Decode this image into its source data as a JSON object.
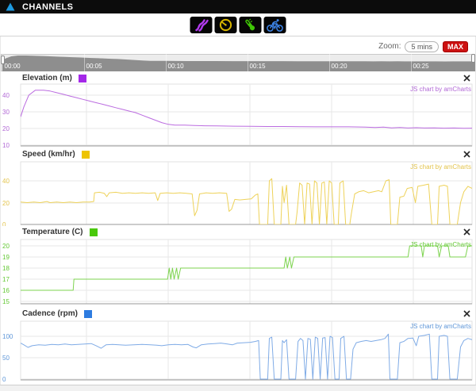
{
  "header": {
    "title": "CHANNELS"
  },
  "toolbar": {
    "buttons": [
      {
        "id": "elevation",
        "icon": "waves-icon",
        "color": "#b23aee"
      },
      {
        "id": "speed",
        "icon": "speedometer-icon",
        "color": "#d8b600"
      },
      {
        "id": "temperature",
        "icon": "thermometer-icon",
        "color": "#3fc506"
      },
      {
        "id": "cadence",
        "icon": "cyclist-icon",
        "color": "#3d85ea"
      }
    ]
  },
  "zoom_controls": {
    "label": "Zoom:",
    "preset_label": "5 mins",
    "max_label": "MAX",
    "max_color": "#cc1111"
  },
  "scrubber": {
    "time_labels": [
      "00:00",
      "00:05",
      "00:10",
      "00:15",
      "00:20",
      "00:25"
    ]
  },
  "amcharts_credit": "JS chart by amCharts",
  "chart_data": [
    {
      "type": "line",
      "title": "Elevation (m)",
      "swatch_color": "#a428e8",
      "line_color": "#bb6ce0",
      "label_color": "#b269d6",
      "yticks": [
        40,
        30,
        20,
        10
      ],
      "ylim": [
        9,
        46
      ],
      "x_range_minutes": [
        0,
        27.5
      ],
      "points": [
        [
          0,
          27
        ],
        [
          0.2,
          33
        ],
        [
          0.5,
          40
        ],
        [
          0.9,
          43
        ],
        [
          1.4,
          43
        ],
        [
          1.8,
          42.5
        ],
        [
          2.2,
          41.5
        ],
        [
          2.6,
          40.5
        ],
        [
          3,
          39.5
        ],
        [
          3.4,
          38.5
        ],
        [
          3.8,
          37.5
        ],
        [
          4.2,
          36.5
        ],
        [
          4.6,
          35.5
        ],
        [
          5,
          34.5
        ],
        [
          5.4,
          33.5
        ],
        [
          5.8,
          32.5
        ],
        [
          6.2,
          31.5
        ],
        [
          6.6,
          30.5
        ],
        [
          7,
          29.5
        ],
        [
          7.4,
          28
        ],
        [
          7.8,
          26.5
        ],
        [
          8.2,
          25
        ],
        [
          8.6,
          23.5
        ],
        [
          9,
          22.5
        ],
        [
          9.4,
          22
        ],
        [
          10,
          22
        ],
        [
          10.6,
          21.8
        ],
        [
          11.2,
          21.6
        ],
        [
          12,
          21.5
        ],
        [
          13,
          21.4
        ],
        [
          14,
          21.3
        ],
        [
          15,
          21.2
        ],
        [
          16,
          21.2
        ],
        [
          17,
          21.1
        ],
        [
          18,
          21
        ],
        [
          19,
          21
        ],
        [
          20,
          21
        ],
        [
          21,
          20.8
        ],
        [
          21.6,
          20.6
        ],
        [
          22.1,
          20.8
        ],
        [
          22.6,
          20.4
        ],
        [
          23.1,
          20.6
        ],
        [
          23.6,
          20.3
        ],
        [
          24.1,
          20.5
        ],
        [
          24.6,
          20.3
        ],
        [
          25.2,
          20.4
        ],
        [
          25.8,
          20.2
        ],
        [
          26.4,
          20.3
        ],
        [
          27,
          20.1
        ],
        [
          27.5,
          20.2
        ]
      ]
    },
    {
      "type": "line",
      "title": "Speed (km/hr)",
      "swatch_color": "#eec400",
      "line_color": "#eed259",
      "label_color": "#e3c44c",
      "yticks": [
        40,
        20,
        0
      ],
      "ylim": [
        0,
        57
      ],
      "x_range_minutes": [
        0,
        27.5
      ],
      "points": [
        [
          0,
          20.5
        ],
        [
          0.4,
          20
        ],
        [
          0.8,
          20.5
        ],
        [
          1.2,
          20
        ],
        [
          1.6,
          21
        ],
        [
          1.8,
          20
        ],
        [
          2.2,
          20.5
        ],
        [
          2.6,
          20
        ],
        [
          3,
          20.5
        ],
        [
          3.4,
          20
        ],
        [
          3.8,
          20.5
        ],
        [
          4.2,
          20.5
        ],
        [
          4.45,
          21
        ],
        [
          4.5,
          29
        ],
        [
          4.8,
          29.5
        ],
        [
          5.1,
          28.5
        ],
        [
          5.25,
          25.5
        ],
        [
          5.4,
          29
        ],
        [
          5.8,
          29.5
        ],
        [
          6.2,
          28.5
        ],
        [
          6.6,
          29
        ],
        [
          7,
          28.5
        ],
        [
          7.4,
          29
        ],
        [
          7.8,
          28.5
        ],
        [
          8.2,
          29
        ],
        [
          8.35,
          22
        ],
        [
          8.5,
          28.5
        ],
        [
          8.9,
          29
        ],
        [
          9.3,
          28.5
        ],
        [
          9.7,
          29
        ],
        [
          10.1,
          28.5
        ],
        [
          10.45,
          28
        ],
        [
          10.6,
          8
        ],
        [
          10.75,
          13
        ],
        [
          10.9,
          28
        ],
        [
          11.3,
          29
        ],
        [
          11.7,
          28.5
        ],
        [
          12.1,
          29
        ],
        [
          12.55,
          28.5
        ],
        [
          12.7,
          12
        ],
        [
          12.85,
          14
        ],
        [
          13.05,
          23
        ],
        [
          13.35,
          22.5
        ],
        [
          13.7,
          23
        ],
        [
          14.05,
          23.5
        ],
        [
          14.3,
          27
        ],
        [
          14.45,
          28
        ],
        [
          14.55,
          0
        ],
        [
          15.05,
          0
        ],
        [
          15.15,
          40
        ],
        [
          15.3,
          42
        ],
        [
          15.45,
          0
        ],
        [
          15.85,
          0
        ],
        [
          15.95,
          35
        ],
        [
          16.05,
          20
        ],
        [
          16.2,
          36
        ],
        [
          16.35,
          0
        ],
        [
          16.75,
          0
        ],
        [
          16.85,
          12
        ],
        [
          17,
          38
        ],
        [
          17.15,
          36
        ],
        [
          17.3,
          0
        ],
        [
          17.45,
          38
        ],
        [
          17.6,
          37
        ],
        [
          17.75,
          0
        ],
        [
          17.9,
          40
        ],
        [
          18.05,
          38
        ],
        [
          18.2,
          0
        ],
        [
          18.35,
          38
        ],
        [
          18.5,
          39
        ],
        [
          18.65,
          0
        ],
        [
          18.8,
          40
        ],
        [
          18.95,
          38
        ],
        [
          19.1,
          0
        ],
        [
          19.35,
          0
        ],
        [
          19.45,
          38
        ],
        [
          19.65,
          40
        ],
        [
          19.8,
          0
        ],
        [
          20.05,
          0
        ],
        [
          20.15,
          10
        ],
        [
          20.35,
          28
        ],
        [
          20.6,
          30
        ],
        [
          20.9,
          31
        ],
        [
          21.2,
          29
        ],
        [
          21.5,
          30
        ],
        [
          21.8,
          31
        ],
        [
          22,
          30
        ],
        [
          22.25,
          40
        ],
        [
          22.45,
          41
        ],
        [
          22.55,
          0
        ],
        [
          22.95,
          0
        ],
        [
          23.1,
          25
        ],
        [
          23.35,
          26
        ],
        [
          23.55,
          33
        ],
        [
          23.85,
          34
        ],
        [
          24.05,
          20
        ],
        [
          24.2,
          35
        ],
        [
          24.55,
          36
        ],
        [
          24.85,
          37
        ],
        [
          25.05,
          0
        ],
        [
          25.4,
          0
        ],
        [
          25.5,
          35
        ],
        [
          25.8,
          36
        ],
        [
          26,
          35
        ],
        [
          26.15,
          0
        ],
        [
          26.6,
          0
        ],
        [
          26.8,
          20
        ],
        [
          27,
          30
        ],
        [
          27.25,
          35
        ],
        [
          27.5,
          33
        ]
      ]
    },
    {
      "type": "line",
      "title": "Temperature (C)",
      "swatch_color": "#49c80a",
      "line_color": "#7dd34f",
      "label_color": "#62c832",
      "yticks": [
        20,
        19,
        18,
        17,
        16,
        15
      ],
      "ylim": [
        14.8,
        20.6
      ],
      "x_range_minutes": [
        0,
        27.5
      ],
      "points": [
        [
          0,
          16
        ],
        [
          3.2,
          16
        ],
        [
          3.25,
          17
        ],
        [
          8.95,
          17
        ],
        [
          9.05,
          18
        ],
        [
          9.15,
          17
        ],
        [
          9.25,
          18
        ],
        [
          9.35,
          17
        ],
        [
          9.5,
          18
        ],
        [
          9.6,
          17
        ],
        [
          9.75,
          18
        ],
        [
          16.05,
          18
        ],
        [
          16.15,
          19
        ],
        [
          16.25,
          18
        ],
        [
          16.4,
          19
        ],
        [
          16.5,
          18
        ],
        [
          16.65,
          19
        ],
        [
          23.6,
          19
        ],
        [
          23.7,
          20
        ],
        [
          24.4,
          20
        ],
        [
          24.5,
          19
        ],
        [
          24.6,
          20
        ],
        [
          25.4,
          20
        ],
        [
          25.5,
          19
        ],
        [
          25.65,
          20
        ],
        [
          26.05,
          20
        ],
        [
          26.15,
          19
        ],
        [
          27.1,
          19
        ],
        [
          27.25,
          20
        ],
        [
          27.5,
          20
        ]
      ]
    },
    {
      "type": "line",
      "title": "Cadence (rpm)",
      "swatch_color": "#2e7ce0",
      "line_color": "#7fabe6",
      "label_color": "#5e96d8",
      "yticks": [
        100,
        50,
        0
      ],
      "ylim": [
        0,
        137
      ],
      "x_range_minutes": [
        0,
        27.5
      ],
      "points": [
        [
          0,
          84
        ],
        [
          0.2,
          80
        ],
        [
          0.45,
          74
        ],
        [
          0.7,
          78
        ],
        [
          1.1,
          80
        ],
        [
          1.5,
          79
        ],
        [
          1.9,
          81
        ],
        [
          2.3,
          80
        ],
        [
          2.7,
          82
        ],
        [
          3.1,
          80
        ],
        [
          3.5,
          81
        ],
        [
          3.9,
          82
        ],
        [
          4.3,
          83
        ],
        [
          4.6,
          78
        ],
        [
          4.9,
          72
        ],
        [
          5.2,
          80
        ],
        [
          5.6,
          81
        ],
        [
          6,
          80
        ],
        [
          6.4,
          79
        ],
        [
          6.9,
          80
        ],
        [
          7.4,
          81
        ],
        [
          7.9,
          80
        ],
        [
          8.3,
          79
        ],
        [
          8.6,
          78
        ],
        [
          9,
          80
        ],
        [
          9.4,
          81
        ],
        [
          9.8,
          80
        ],
        [
          10.2,
          81
        ],
        [
          10.5,
          75
        ],
        [
          10.7,
          73
        ],
        [
          11,
          80
        ],
        [
          11.4,
          82
        ],
        [
          11.8,
          83
        ],
        [
          12.2,
          84
        ],
        [
          12.6,
          82
        ],
        [
          12.9,
          80
        ],
        [
          13.2,
          84
        ],
        [
          13.6,
          85
        ],
        [
          14,
          86
        ],
        [
          14.3,
          88
        ],
        [
          14.5,
          90
        ],
        [
          14.6,
          0
        ],
        [
          15.05,
          0
        ],
        [
          15.15,
          95
        ],
        [
          15.3,
          98
        ],
        [
          15.45,
          0
        ],
        [
          15.85,
          0
        ],
        [
          15.95,
          90
        ],
        [
          16.05,
          85
        ],
        [
          16.2,
          92
        ],
        [
          16.35,
          0
        ],
        [
          16.75,
          0
        ],
        [
          16.9,
          88
        ],
        [
          17.05,
          95
        ],
        [
          17.2,
          90
        ],
        [
          17.35,
          0
        ],
        [
          17.5,
          95
        ],
        [
          17.65,
          93
        ],
        [
          17.8,
          0
        ],
        [
          17.95,
          98
        ],
        [
          18.1,
          95
        ],
        [
          18.25,
          0
        ],
        [
          18.4,
          96
        ],
        [
          18.55,
          97
        ],
        [
          18.7,
          0
        ],
        [
          18.85,
          100
        ],
        [
          19,
          97
        ],
        [
          19.15,
          0
        ],
        [
          19.4,
          0
        ],
        [
          19.5,
          95
        ],
        [
          19.7,
          100
        ],
        [
          19.85,
          0
        ],
        [
          20.1,
          0
        ],
        [
          20.25,
          70
        ],
        [
          20.45,
          85
        ],
        [
          20.75,
          88
        ],
        [
          21.05,
          90
        ],
        [
          21.35,
          88
        ],
        [
          21.65,
          90
        ],
        [
          21.95,
          92
        ],
        [
          22.2,
          95
        ],
        [
          22.4,
          105
        ],
        [
          22.5,
          0
        ],
        [
          22.95,
          0
        ],
        [
          23.1,
          85
        ],
        [
          23.35,
          88
        ],
        [
          23.6,
          95
        ],
        [
          23.9,
          96
        ],
        [
          24.1,
          78
        ],
        [
          24.25,
          100
        ],
        [
          24.6,
          102
        ],
        [
          24.9,
          105
        ],
        [
          25.05,
          0
        ],
        [
          25.4,
          0
        ],
        [
          25.5,
          100
        ],
        [
          25.8,
          102
        ],
        [
          26,
          100
        ],
        [
          26.15,
          0
        ],
        [
          26.6,
          0
        ],
        [
          26.8,
          75
        ],
        [
          27,
          90
        ],
        [
          27.25,
          95
        ],
        [
          27.5,
          92
        ]
      ]
    }
  ]
}
